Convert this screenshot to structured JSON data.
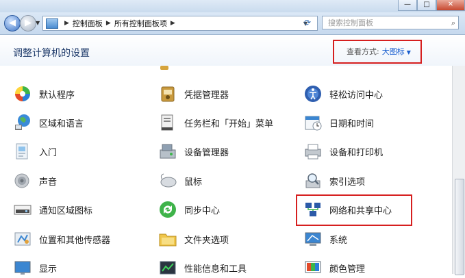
{
  "window": {
    "min_label": "—",
    "max_label": "□",
    "close_label": "✕"
  },
  "nav": {
    "back_glyph": "◀",
    "forward_glyph": "▶",
    "dropdown_glyph": "▼"
  },
  "address": {
    "crumbs": [
      "控制面板",
      "所有控制面板项"
    ],
    "separator_glyph": "▶",
    "dropdown_glyph": "▼",
    "refresh_glyph": "⟳"
  },
  "search": {
    "placeholder": "搜索控制面板",
    "icon_glyph": "⌕"
  },
  "header": {
    "title": "调整计算机的设置",
    "view_label": "查看方式:",
    "view_value": "大图标",
    "view_arrow": "▼"
  },
  "items": [
    {
      "label": "默认程序",
      "icon": "default-programs-icon"
    },
    {
      "label": "凭据管理器",
      "icon": "credential-manager-icon"
    },
    {
      "label": "轻松访问中心",
      "icon": "ease-of-access-icon"
    },
    {
      "label": "区域和语言",
      "icon": "region-language-icon"
    },
    {
      "label": "任务栏和「开始」菜单",
      "icon": "taskbar-start-icon"
    },
    {
      "label": "日期和时间",
      "icon": "date-time-icon"
    },
    {
      "label": "入门",
      "icon": "getting-started-icon"
    },
    {
      "label": "设备管理器",
      "icon": "device-manager-icon"
    },
    {
      "label": "设备和打印机",
      "icon": "devices-printers-icon"
    },
    {
      "label": "声音",
      "icon": "sound-icon"
    },
    {
      "label": "鼠标",
      "icon": "mouse-icon"
    },
    {
      "label": "索引选项",
      "icon": "indexing-options-icon"
    },
    {
      "label": "通知区域图标",
      "icon": "notification-area-icon"
    },
    {
      "label": "同步中心",
      "icon": "sync-center-icon"
    },
    {
      "label": "网络和共享中心",
      "icon": "network-sharing-icon"
    },
    {
      "label": "位置和其他传感器",
      "icon": "location-sensors-icon"
    },
    {
      "label": "文件夹选项",
      "icon": "folder-options-icon"
    },
    {
      "label": "系统",
      "icon": "system-icon"
    },
    {
      "label": "显示",
      "icon": "display-icon"
    },
    {
      "label": "性能信息和工具",
      "icon": "performance-tools-icon"
    },
    {
      "label": "颜色管理",
      "icon": "color-management-icon"
    }
  ],
  "colors": {
    "accent": "#1a5fcf",
    "highlight": "#d61f1f",
    "title": "#1e3a6a"
  }
}
